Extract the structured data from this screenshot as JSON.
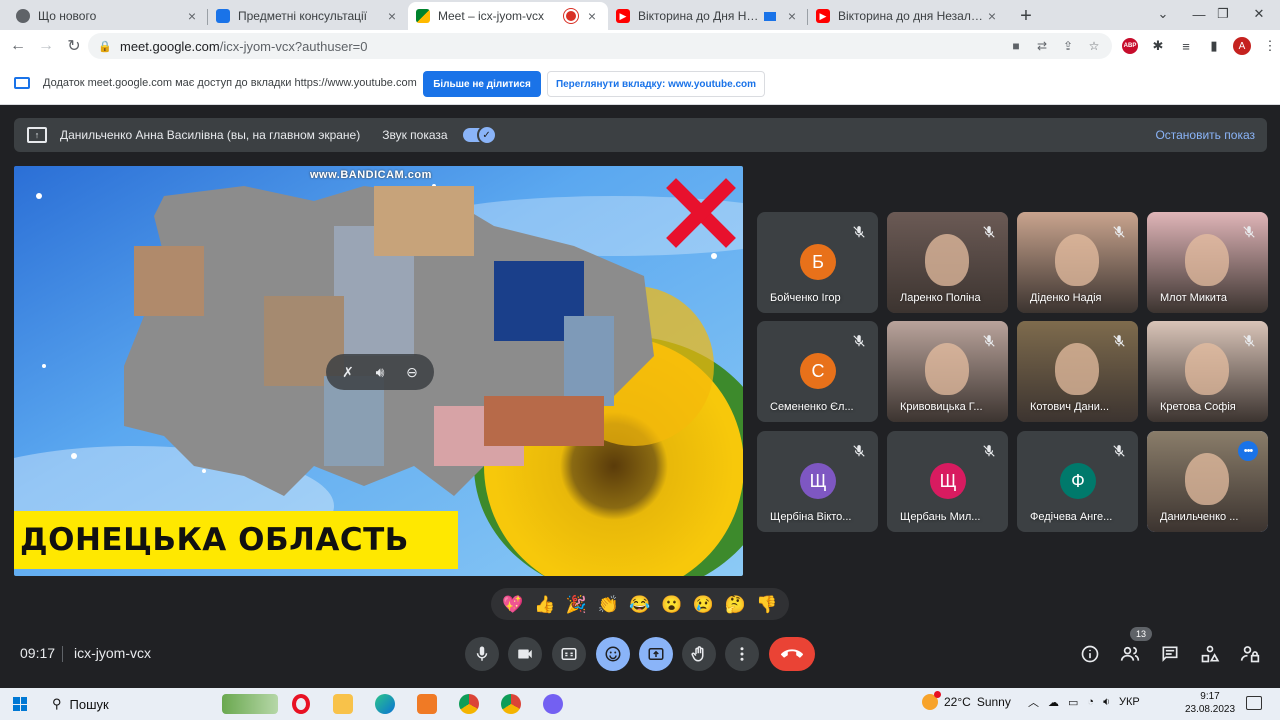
{
  "browser": {
    "tabs": [
      {
        "title": "Що нового",
        "favicon": "chrome-icon",
        "favcolor": "#5f6368",
        "active": false
      },
      {
        "title": "Предметні консультації",
        "favicon": "docs-icon",
        "favcolor": "#1a73e8",
        "active": false
      },
      {
        "title": "Meet – icx-jyom-vcx",
        "favicon": "meet-icon",
        "favcolor": "#00832d",
        "active": true
      },
      {
        "title": "Вікторина до Дня Незалежн",
        "favicon": "youtube-icon",
        "favcolor": "#ff0000",
        "active": false
      },
      {
        "title": "Вікторина до дня Незалежності",
        "favicon": "youtube-icon",
        "favcolor": "#ff0000",
        "active": false
      }
    ],
    "url_host": "meet.google.com",
    "url_path": "/icx-jyom-vcx?authuser=0",
    "profile_initial": "A",
    "abp_label": "ABP"
  },
  "infobar": {
    "message": "Додаток meet.google.com має доступ до вкладки https://www.youtube.com",
    "stop_sharing": "Більше не ділитися",
    "view_tab": "Переглянути вкладку: www.youtube.com"
  },
  "presenting": {
    "text": "Данильченко Анна Василівна (вы, на главном экране)",
    "sound_label": "Звук показа",
    "sound_on": true,
    "stop_label": "Остановить показ"
  },
  "presentation": {
    "watermark": "www.BANDICAM.com",
    "region_title": "ДОНЕЦЬКА ОБЛАСТЬ"
  },
  "participants": [
    {
      "name": "Бойченко Ігор",
      "initial": "Б",
      "color": "#e8711a",
      "video": false
    },
    {
      "name": "Ларенко Поліна",
      "initial": "",
      "color": "",
      "video": true,
      "bg": "#6b5a55"
    },
    {
      "name": "Діденко Надія",
      "initial": "",
      "color": "",
      "video": true,
      "bg": "#c9a48e"
    },
    {
      "name": "Млот Микита",
      "initial": "",
      "color": "",
      "video": true,
      "bg": "#e0b5b8"
    },
    {
      "name": "Семененко Єл...",
      "initial": "С",
      "color": "#e8711a",
      "video": false
    },
    {
      "name": "Кривовицька Г...",
      "initial": "",
      "color": "",
      "video": true,
      "bg": "#b9a39b"
    },
    {
      "name": "Котович Дани...",
      "initial": "",
      "color": "",
      "video": true,
      "bg": "#7e6b4d"
    },
    {
      "name": "Кретова Софія",
      "initial": "",
      "color": "",
      "video": true,
      "bg": "#d9c4b8"
    },
    {
      "name": "Щербіна Вікто...",
      "initial": "Щ",
      "color": "#7e57c2",
      "video": false
    },
    {
      "name": "Щербань Мил...",
      "initial": "Щ",
      "color": "#d81b60",
      "video": false
    },
    {
      "name": "Федічева Анге...",
      "initial": "Ф",
      "color": "#00796b",
      "video": false
    },
    {
      "name": "Данильченко ...",
      "initial": "",
      "color": "",
      "video": true,
      "bg": "#8a7d6a",
      "self": true
    }
  ],
  "reactions": [
    "💖",
    "👍",
    "🎉",
    "👏",
    "😂",
    "😮",
    "😢",
    "🤔",
    "👎"
  ],
  "controls": {
    "time": "09:17",
    "meeting_code": "icx-jyom-vcx",
    "people_count": "13"
  },
  "taskbar": {
    "search_label": "Пошук",
    "weather_temp": "22°C",
    "weather_text": "Sunny",
    "lang": "УКР",
    "time": "9:17",
    "date": "23.08.2023"
  },
  "colors": {
    "accent": "#8ab4f8",
    "danger": "#ea4335",
    "surface": "#3c4043",
    "background": "#202124"
  }
}
